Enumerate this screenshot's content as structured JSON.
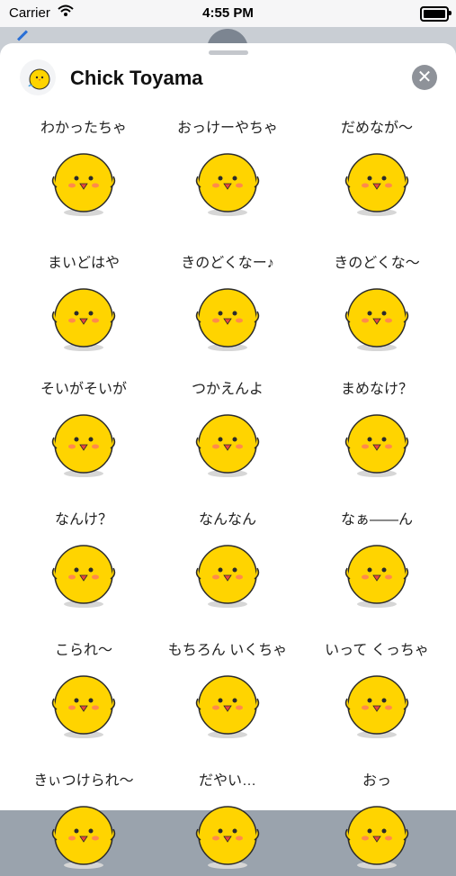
{
  "status_bar": {
    "carrier": "Carrier",
    "time": "4:55 PM"
  },
  "sheet": {
    "title": "Chick Toyama",
    "close_label": "✕"
  },
  "colors": {
    "chick_yellow": "#ffd400",
    "chick_outline": "#2b2b2b",
    "cheek": "#ff6b6b",
    "beak": "#e8473c"
  },
  "stickers": [
    {
      "caption": "わかったちゃ"
    },
    {
      "caption": "おっけーやちゃ"
    },
    {
      "caption": "だめなが～"
    },
    {
      "caption": "まいどはや"
    },
    {
      "caption": "きのどくなー♪"
    },
    {
      "caption": "きのどくな～"
    },
    {
      "caption": "そいがそいが"
    },
    {
      "caption": "つかえんよ"
    },
    {
      "caption": "まめなけ？"
    },
    {
      "caption": "なんけ？"
    },
    {
      "caption": "なんなん"
    },
    {
      "caption": "なぁ——ん"
    },
    {
      "caption": "こられ～"
    },
    {
      "caption": "もちろん いくちゃ"
    },
    {
      "caption": "いって くっちゃ"
    },
    {
      "caption": "きぃつけられ～"
    },
    {
      "caption": "だやい…"
    },
    {
      "caption": "おっ"
    }
  ]
}
